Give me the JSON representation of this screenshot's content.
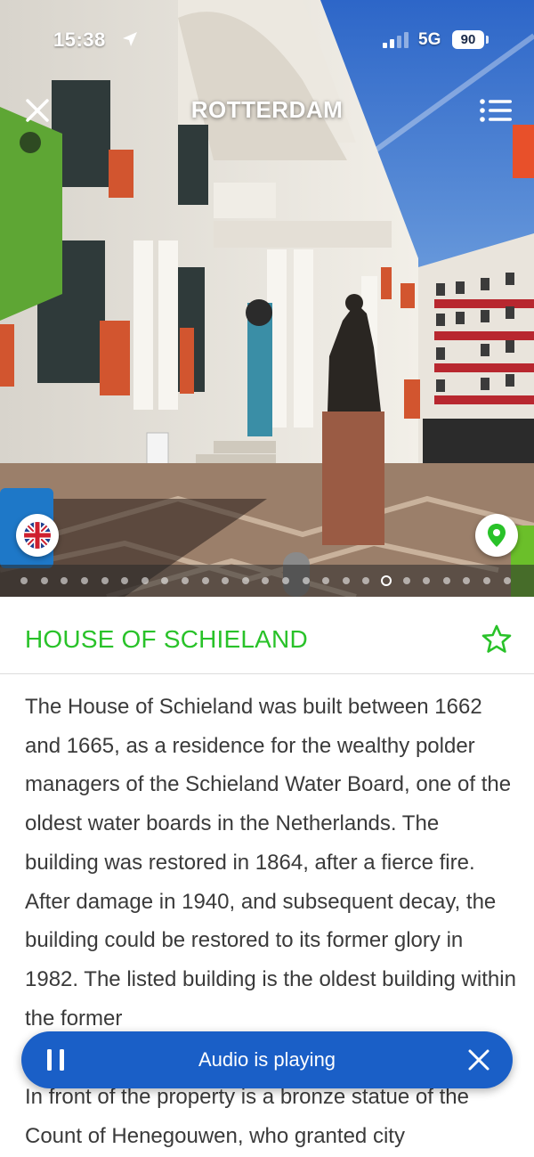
{
  "status_bar": {
    "time": "15:38",
    "network": "5G",
    "battery": "90"
  },
  "nav": {
    "city": "ROTTERDAM"
  },
  "icons": {
    "close": "close-icon",
    "menu": "list-menu-icon",
    "language": "uk-flag-icon",
    "map": "map-pin-icon",
    "favorite": "star-outline-icon",
    "pause": "pause-icon",
    "audio_close": "close-icon"
  },
  "gallery": {
    "total_images": 25,
    "active_index": 18
  },
  "place": {
    "title": "HOUSE OF SCHIELAND",
    "description": "The House of Schieland was built between 1662 and 1665, as a residence for the wealthy polder managers of the Schieland Water Board, one of the oldest water boards in the Netherlands. The building was restored in 1864, after a fierce fire. After damage in 1940, and subsequent decay, the building could be restored to its former glory in 1982. The listed building is the oldest building within the former",
    "description_continued": "In front of the property is a bronze statue of the Count of Henegouwen, who granted city"
  },
  "audio": {
    "status": "Audio is playing"
  },
  "colors": {
    "accent_green": "#29c229",
    "audio_blue": "#1a5fc7",
    "text": "#3a3a3a"
  }
}
